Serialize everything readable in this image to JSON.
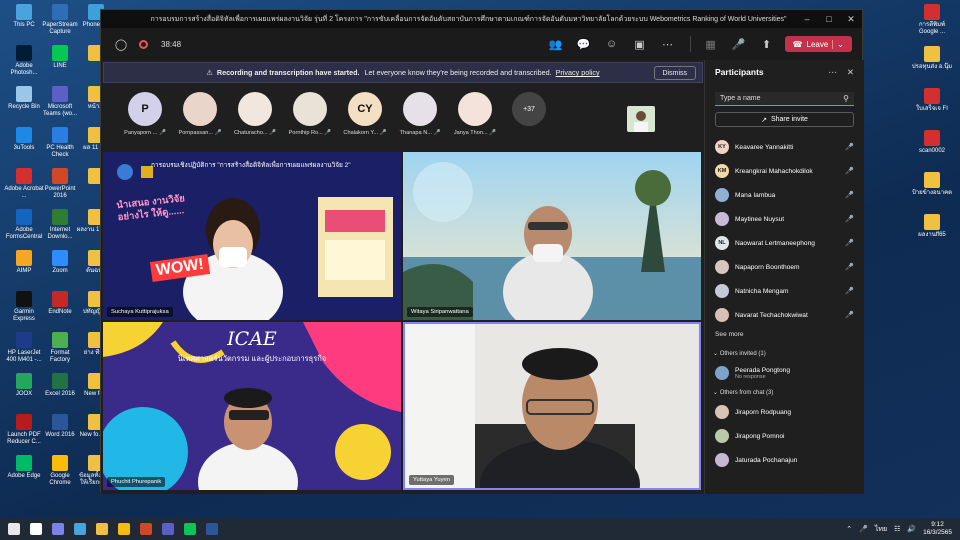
{
  "meeting": {
    "title": "การอบรมการสร้างสื่อดิจิทัลเพื่อการเผยแพร่ผลงานวิจัย รุ่นที่ 2 โครงการ \"การขับเคลื่อนการจัดอันดับสถาบันการศึกษาตามเกณฑ์การจัดอันดับมหาวิทยาลัยโลกด้วยระบบ Webometrics Ranking of World Universities\"",
    "timer": "38:48",
    "leave_label": "Leave"
  },
  "banner": {
    "strong": "Recording and transcription have started.",
    "text": "Let everyone know they're being recorded and transcribed.",
    "link": "Privacy policy",
    "dismiss": "Dismiss"
  },
  "gallery": [
    {
      "initials": "P",
      "name": "Panyaporn ...",
      "color": "#d3d0ea"
    },
    {
      "initials": "",
      "name": "Pornpassan...",
      "color": "#e9d5c9"
    },
    {
      "initials": "",
      "name": "Chaturacho...",
      "color": "#f1e7df"
    },
    {
      "initials": "",
      "name": "Pornthip Ro...",
      "color": "#e9e2d6"
    },
    {
      "initials": "CY",
      "name": "Chalakorn Y...",
      "color": "#f3dfc2"
    },
    {
      "initials": "",
      "name": "Thanapa N...",
      "color": "#e6e1e8"
    },
    {
      "initials": "",
      "name": "Janya Thon...",
      "color": "#f3e3db"
    }
  ],
  "more_count": "+37",
  "tiles": [
    {
      "name": "Suchaya Kuttiprajuksa",
      "heading": "การอบรมเชิงปฏิบัติการ \"การสร้างสื่อดิจิทัลเพื่อการเผยแพร่ผลงานวิจัย 2\"",
      "slogan": "นำเสนอ งานวิจัยอย่างไร ให้ดู......",
      "wow": "WOW!"
    },
    {
      "name": "Witaya Siripanwattana"
    },
    {
      "name": "Phuchit Phurepanik",
      "logo": "ICAE",
      "sub": "นิเทศศาสตร์นวัตกรรม และผู้ประกอบการธุรกิจ"
    },
    {
      "name": "Yuttaya Yuyen"
    }
  ],
  "participants": {
    "title": "Participants",
    "search_placeholder": "Type a name",
    "share_invite": "Share invite",
    "in_meeting": [
      {
        "initials": "KY",
        "name": "Keavaree Yannakitti",
        "color": "#f3d2c4"
      },
      {
        "initials": "KM",
        "name": "Kreangkrai Mahachokdilok",
        "color": "#f3d9a7"
      },
      {
        "initials": "",
        "name": "Mana Iambua",
        "color": "#8fb1d4"
      },
      {
        "initials": "",
        "name": "Maytinee Nuysut",
        "color": "#c9b9d8"
      },
      {
        "initials": "NL",
        "name": "Naowarat Lertmaneephong",
        "color": "#dfe6eb"
      },
      {
        "initials": "",
        "name": "Napaporn Boonthoem",
        "color": "#d6c6be"
      },
      {
        "initials": "",
        "name": "Natnicha Mengam",
        "color": "#c7c9d9"
      },
      {
        "initials": "",
        "name": "Navarat Techachokwiwat",
        "color": "#d8c0b8"
      }
    ],
    "see_more": "See more",
    "invited_header": "Others invited (1)",
    "invited": [
      {
        "name": "Peerada Pongtong",
        "status": "No response",
        "color": "#7ea3c9"
      }
    ],
    "chat_header": "Others from chat (3)",
    "from_chat": [
      {
        "name": "Jiraporn Rodpuang",
        "color": "#d9c3b7"
      },
      {
        "name": "Jirapong Pomnoi",
        "color": "#b9c9a7"
      },
      {
        "name": "Jaturada Pochanajun",
        "color": "#c7b7d1"
      }
    ]
  },
  "desktop_left": [
    {
      "label": "This PC",
      "color": "#4aa3df"
    },
    {
      "label": "PaperStream Capture",
      "color": "#2f6db5"
    },
    {
      "label": "PhoneC...",
      "color": "#3da0d8"
    },
    {
      "label": "Adobe Photosh...",
      "color": "#001d35"
    },
    {
      "label": "LINE",
      "color": "#06c755"
    },
    {
      "label": "",
      "color": "#f0c040"
    },
    {
      "label": "Recycle Bin",
      "color": "#9cc6e8"
    },
    {
      "label": "Microsoft Teams (wo...",
      "color": "#5b5fc7"
    },
    {
      "label": "หน้า...",
      "color": "#f0c040"
    },
    {
      "label": "3uTools",
      "color": "#1e88e5"
    },
    {
      "label": "PC Health Check",
      "color": "#2a7de1"
    },
    {
      "label": "ผล 11 พ...",
      "color": "#f0c040"
    },
    {
      "label": "Adobe Acrobat ...",
      "color": "#d32f2f"
    },
    {
      "label": "PowerPoint 2016",
      "color": "#d24726"
    },
    {
      "label": "",
      "color": "#f0c040"
    },
    {
      "label": "Adobe FormsCentral",
      "color": "#1565c0"
    },
    {
      "label": "Internet Downlo...",
      "color": "#2e7d32"
    },
    {
      "label": "ผลงาน 17ลด...",
      "color": "#f0c040"
    },
    {
      "label": "AIMP",
      "color": "#f5a623"
    },
    {
      "label": "Zoom",
      "color": "#2d8cff"
    },
    {
      "label": "ต้นฉบับ",
      "color": "#f0c040"
    },
    {
      "label": "Garmin Express",
      "color": "#111"
    },
    {
      "label": "EndNote",
      "color": "#c62828"
    },
    {
      "label": "ปทัญญิ 64",
      "color": "#f0c040"
    },
    {
      "label": "HP LaserJet 400 M401 -...",
      "color": "#1e3a8a"
    },
    {
      "label": "Format Factory",
      "color": "#4caf50"
    },
    {
      "label": "ย่าง ทีม...",
      "color": "#f0c040"
    },
    {
      "label": "JOOX",
      "color": "#26a65b"
    },
    {
      "label": "Excel 2016",
      "color": "#217346"
    },
    {
      "label": "New fo...",
      "color": "#f0c040"
    },
    {
      "label": "Launch PDF Reducer C...",
      "color": "#b71c1c"
    },
    {
      "label": "Word 2016",
      "color": "#2b579a"
    },
    {
      "label": "New fo... (3)",
      "color": "#f0c040"
    },
    {
      "label": "Adobe Edge",
      "color": "#0b6"
    },
    {
      "label": "Google Chrome",
      "color": "#fbbc05"
    },
    {
      "label": "ข้อมูลทั้งหมด ให้เรียกดูดู...",
      "color": "#f0c040"
    }
  ],
  "desktop_right": [
    {
      "label": "การตีพิมพ์ Google ...",
      "color": "#d32f2f"
    },
    {
      "label": "ปรอทุนส่ง อ.นุ๊ม",
      "color": "#f0c040"
    },
    {
      "label": "ใบเสร็จเจ FI",
      "color": "#d32f2f"
    },
    {
      "label": "scan0002",
      "color": "#d32f2f"
    },
    {
      "label": "ป้ายข้างอนาคต",
      "color": "#f0c040"
    },
    {
      "label": "ผลงานff65",
      "color": "#f0c040"
    }
  ],
  "taskbar": {
    "apps": [
      "#e8e8e8",
      "#ffffff",
      "#7b83eb",
      "#4aa3df",
      "#f0c040",
      "#fbbc05",
      "#d24726",
      "#5b5fc7",
      "#06c755",
      "#2b579a"
    ],
    "lang": "ไทย",
    "time": "9:12",
    "date": "16/3/2565"
  }
}
